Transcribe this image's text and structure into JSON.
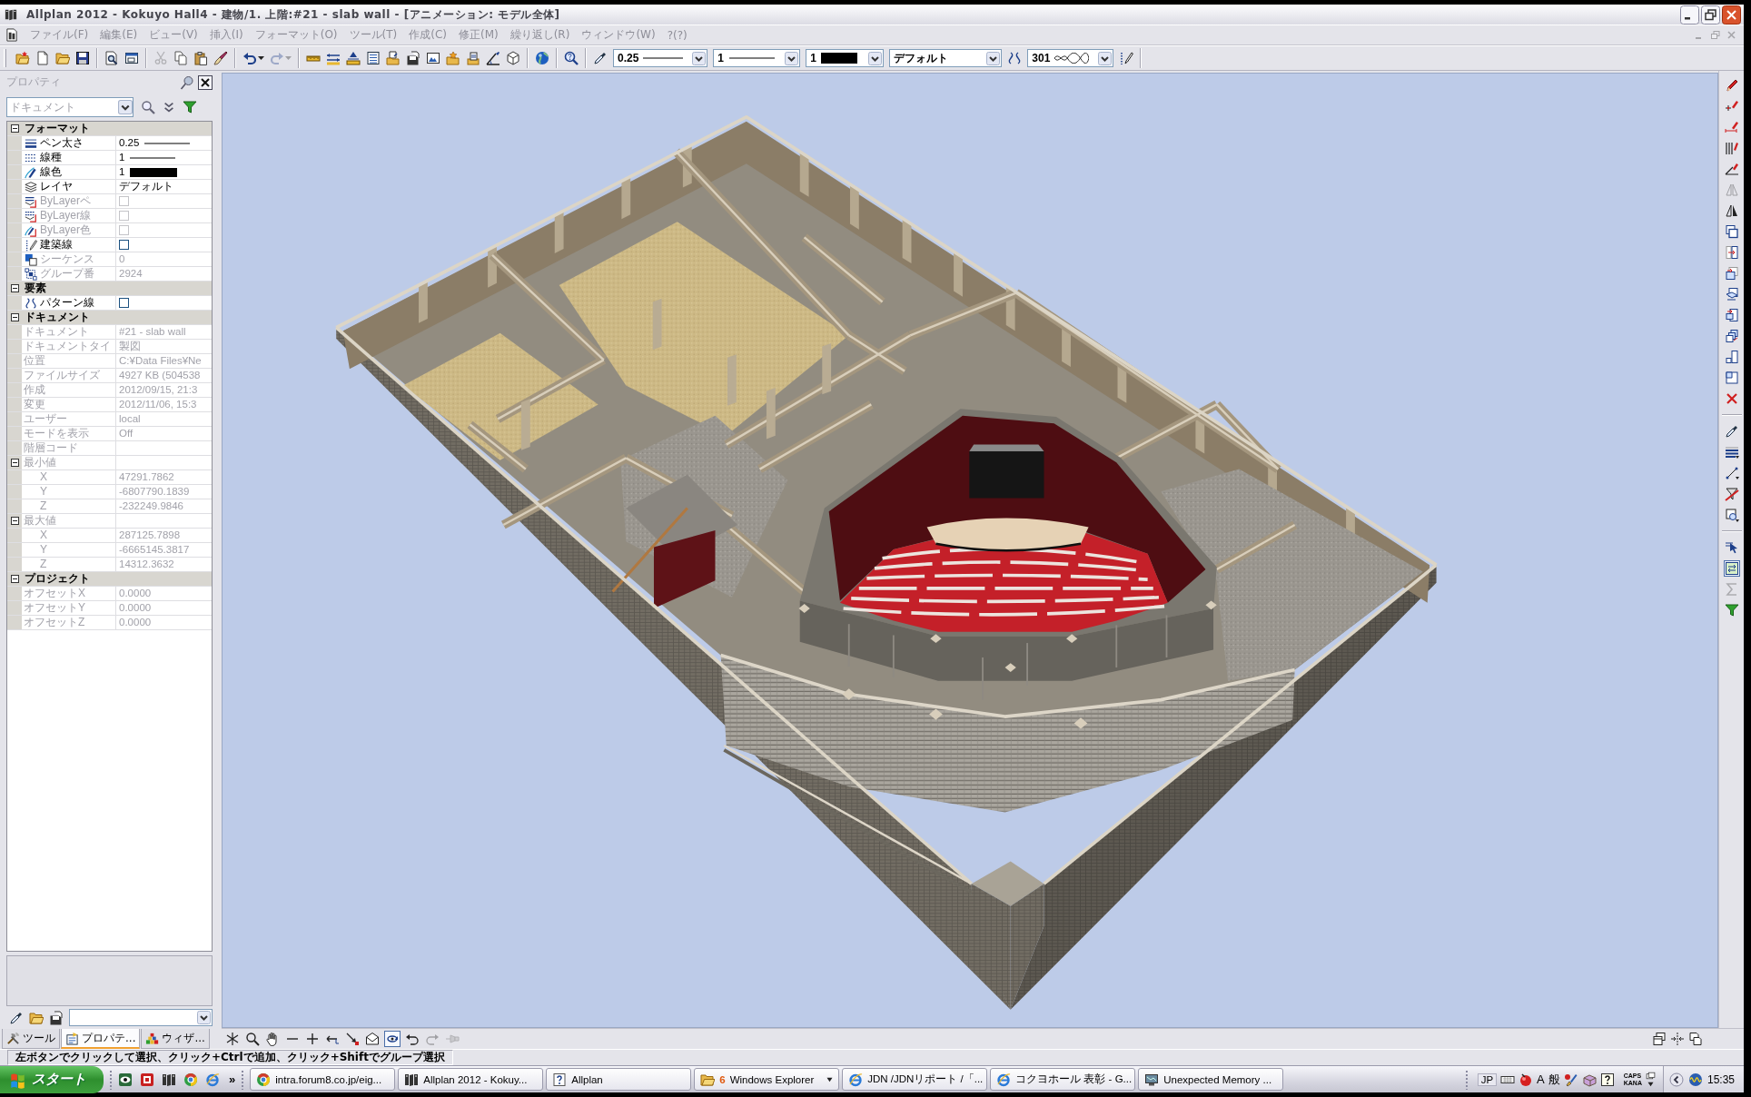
{
  "window": {
    "title": "Allplan 2012 - Kokuyo Hall4 - 建物/1. 上階:#21 - slab wall - [アニメーション: モデル全体]",
    "document_controls": {
      "disabled": true
    }
  },
  "menu": [
    {
      "label": "ファイル(F)",
      "disabled": true
    },
    {
      "label": "編集(E)",
      "disabled": true
    },
    {
      "label": "ビュー(V)",
      "disabled": true
    },
    {
      "label": "挿入(I)",
      "disabled": true
    },
    {
      "label": "フォーマット(O)",
      "disabled": true
    },
    {
      "label": "ツール(T)",
      "disabled": true
    },
    {
      "label": "作成(C)",
      "disabled": true
    },
    {
      "label": "修正(M)",
      "disabled": true
    },
    {
      "label": "繰り返し(R)",
      "disabled": true
    },
    {
      "label": "ウィンドウ(W)",
      "disabled": true
    },
    {
      "label": "?(?)",
      "disabled": true
    }
  ],
  "toolbar": {
    "buttons": [
      {
        "disabled": false
      },
      {
        "disabled": false
      },
      {
        "disabled": false
      },
      {
        "disabled": false
      },
      {
        "disabled": false
      },
      {
        "disabled": false
      },
      {
        "disabled": true
      },
      {
        "disabled": false
      },
      {
        "disabled": false
      },
      {
        "disabled": false
      },
      {
        "disabled": false
      },
      {
        "disabled": true
      },
      {
        "disabled": false
      },
      {
        "disabled": false
      },
      {
        "disabled": false
      },
      {
        "disabled": false
      },
      {
        "disabled": false
      },
      {
        "disabled": false
      },
      {
        "disabled": false
      },
      {
        "disabled": false
      },
      {
        "disabled": false
      },
      {
        "disabled": false
      },
      {
        "disabled": false
      },
      {
        "disabled": false
      },
      {
        "disabled": false
      },
      {
        "disabled": false
      },
      {
        "disabled": false
      },
      {
        "disabled": false
      }
    ],
    "pen_thickness": "0.25",
    "line_type": "1",
    "line_color": "1",
    "layer": "デフォルト",
    "pattern": "301"
  },
  "properties": {
    "title": "プロパティ",
    "selector": {
      "value": "ドキュメント",
      "disabled": true
    },
    "groups": [
      {
        "label": "フォーマット",
        "expanded": true,
        "rows": [
          {
            "name": "ペン太さ",
            "value": "0.25",
            "kind": "pen",
            "disabled": false
          },
          {
            "name": "線種",
            "value": "1",
            "kind": "line",
            "disabled": false
          },
          {
            "name": "線色",
            "value": "1",
            "kind": "color",
            "disabled": false
          },
          {
            "name": "レイヤ",
            "value": "デフォルト",
            "kind": "text",
            "disabled": false
          },
          {
            "name": "ByLayerペ",
            "kind": "checkbox",
            "checked": false,
            "disabled": true
          },
          {
            "name": "ByLayer線",
            "kind": "checkbox",
            "checked": false,
            "disabled": true
          },
          {
            "name": "ByLayer色",
            "kind": "checkbox",
            "checked": false,
            "disabled": true
          },
          {
            "name": "建築線",
            "kind": "checkbox",
            "checked": false,
            "disabled": false
          },
          {
            "name": "シーケンス",
            "value": "0",
            "kind": "text",
            "disabled": true
          },
          {
            "name": "グループ番",
            "value": "2924",
            "kind": "text",
            "disabled": true
          }
        ]
      },
      {
        "label": "要素",
        "expanded": true,
        "rows": [
          {
            "name": "パターン線",
            "kind": "checkbox",
            "checked": false,
            "disabled": false
          }
        ]
      },
      {
        "label": "ドキュメント",
        "expanded": true,
        "rows": [
          {
            "name": "ドキュメント",
            "value": "#21 - slab wall",
            "kind": "text",
            "disabled": true
          },
          {
            "name": "ドキュメントタイ",
            "value": "製図",
            "kind": "text",
            "disabled": true
          },
          {
            "name": "位置",
            "value": "C:¥Data Files¥Ne",
            "kind": "text",
            "disabled": true
          },
          {
            "name": "ファイルサイズ",
            "value": "4927 KB (504538",
            "kind": "text",
            "disabled": true
          },
          {
            "name": "作成",
            "value": "2012/09/15, 21:3",
            "kind": "text",
            "disabled": true
          },
          {
            "name": "変更",
            "value": "2012/11/06, 15:3",
            "kind": "text",
            "disabled": true
          },
          {
            "name": "ユーザー",
            "value": "local",
            "kind": "text",
            "disabled": true
          },
          {
            "name": "モードを表示",
            "value": "Off",
            "kind": "text",
            "disabled": true
          },
          {
            "name": "階層コード",
            "kind": "text",
            "disabled": true
          },
          {
            "name": "最小値",
            "kind": "group",
            "expanded": true,
            "disabled": true,
            "children": [
              {
                "name": "X",
                "value": "47291.7862",
                "kind": "text",
                "disabled": true
              },
              {
                "name": "Y",
                "value": "-6807790.1839",
                "kind": "text",
                "disabled": true
              },
              {
                "name": "Z",
                "value": "-232249.9846",
                "kind": "text",
                "disabled": true
              }
            ]
          },
          {
            "name": "最大値",
            "kind": "group",
            "expanded": true,
            "disabled": true,
            "children": [
              {
                "name": "X",
                "value": "287125.7898",
                "kind": "text",
                "disabled": true
              },
              {
                "name": "Y",
                "value": "-6665145.3817",
                "kind": "text",
                "disabled": true
              },
              {
                "name": "Z",
                "value": "14312.3632",
                "kind": "text",
                "disabled": true
              }
            ]
          }
        ]
      },
      {
        "label": "プロジェクト",
        "expanded": true,
        "rows": [
          {
            "name": "オフセットX",
            "value": "0.0000",
            "kind": "text",
            "disabled": true
          },
          {
            "name": "オフセットY",
            "value": "0.0000",
            "kind": "text",
            "disabled": true
          },
          {
            "name": "オフセットZ",
            "value": "0.0000",
            "kind": "text",
            "disabled": true
          }
        ]
      }
    ],
    "tabs": [
      {
        "label": "ツール",
        "selected": false
      },
      {
        "label": "プロパテ...",
        "selected": true
      },
      {
        "label": "ウィザ...",
        "selected": false
      }
    ]
  },
  "viewport": {
    "tools": [
      {
        "selected": false,
        "disabled": false
      },
      {
        "selected": false,
        "disabled": false
      },
      {
        "selected": false,
        "disabled": false
      },
      {
        "selected": false,
        "disabled": false
      },
      {
        "selected": false,
        "disabled": false
      },
      {
        "selected": false,
        "disabled": false
      },
      {
        "selected": false,
        "disabled": false
      },
      {
        "selected": false,
        "disabled": false
      },
      {
        "selected": true,
        "disabled": false
      },
      {
        "selected": false,
        "disabled": false
      },
      {
        "selected": false,
        "disabled": true
      },
      {
        "selected": false,
        "disabled": true
      }
    ]
  },
  "tool_palette": [
    {
      "selected": false,
      "disabled": false
    },
    {
      "selected": false,
      "disabled": false
    },
    {
      "selected": false,
      "disabled": false
    },
    {
      "selected": false,
      "disabled": false
    },
    {
      "selected": false,
      "disabled": false
    },
    {
      "selected": false,
      "disabled": true
    },
    {
      "selected": false,
      "disabled": false
    },
    {
      "selected": false,
      "disabled": false
    },
    {
      "selected": false,
      "disabled": false
    },
    {
      "selected": false,
      "disabled": false
    },
    {
      "selected": false,
      "disabled": false
    },
    {
      "selected": false,
      "disabled": false
    },
    {
      "selected": false,
      "disabled": false
    },
    {
      "selected": false,
      "disabled": false
    },
    {
      "selected": false,
      "disabled": false
    },
    {
      "selected": false,
      "disabled": false
    },
    {
      "selected": false,
      "disabled": false
    },
    {
      "selected": false,
      "disabled": false
    },
    {
      "selected": false,
      "disabled": false
    },
    {
      "selected": false,
      "disabled": false
    },
    {
      "selected": false,
      "disabled": false
    },
    {
      "selected": false,
      "disabled": false
    },
    {
      "selected": true,
      "disabled": false
    },
    {
      "selected": false,
      "disabled": true
    },
    {
      "selected": false,
      "disabled": false
    }
  ],
  "status_bar": {
    "text": "左ボタンでクリックして選択、クリック+Ctrlで追加、クリック+Shiftでグループ選択"
  },
  "taskbar": {
    "start": "スタート",
    "more": "»",
    "tasks": [
      {
        "label": "intra.forum8.co.jp/eig...",
        "selected": false
      },
      {
        "label": "Allplan 2012 - Kokuy...",
        "selected": false
      },
      {
        "label": "Allplan",
        "selected": false
      },
      {
        "count": "6",
        "label": "Windows Explorer",
        "selected": false
      },
      {
        "label": "JDN /JDNリポート /「...",
        "selected": false
      },
      {
        "label": "コクヨホール 表彰 - G...",
        "selected": false
      },
      {
        "label": "Unexpected Memory ...",
        "selected": false
      }
    ],
    "tray": {
      "language": "JP",
      "ime_mode": "A",
      "ime_dictionary": "般",
      "caps": "CAPS",
      "kana": "KANA",
      "clock": "15:35"
    }
  }
}
